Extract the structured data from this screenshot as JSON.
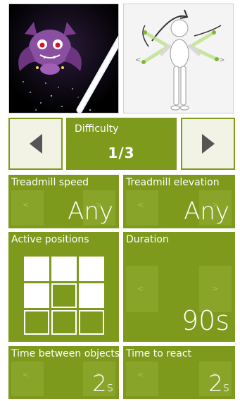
{
  "difficulty": {
    "label": "Difficulty",
    "value": "1/3"
  },
  "settings": {
    "treadmill_speed": {
      "label": "Treadmill speed",
      "value": "Any"
    },
    "treadmill_elevation": {
      "label": "Treadmill elevation",
      "value": "Any"
    },
    "active_positions": {
      "label": "Active positions",
      "grid": [
        [
          true,
          true,
          true
        ],
        [
          true,
          false,
          true
        ],
        [
          false,
          false,
          false
        ]
      ]
    },
    "duration": {
      "label": "Duration",
      "value": "90s"
    },
    "time_between_objects": {
      "label": "Time between objects",
      "value": "2",
      "unit": "s"
    },
    "time_to_react": {
      "label": "Time to react",
      "value": "2",
      "unit": "s"
    }
  },
  "icons": {
    "prev": "triangle-left-icon",
    "next": "triangle-right-icon",
    "stepper_left": "chevron-left-icon",
    "stepper_right": "chevron-right-icon"
  },
  "colors": {
    "accent": "#7d9a1d",
    "button_bg": "#f3f3e5",
    "arrow": "#555555"
  }
}
